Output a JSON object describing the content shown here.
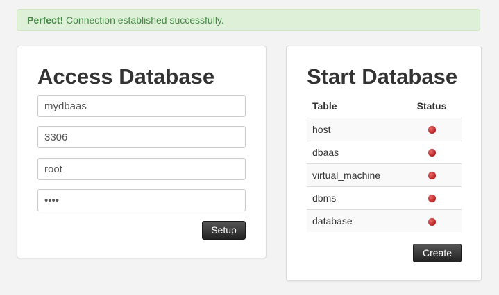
{
  "alert": {
    "strong": "Perfect!",
    "message": " Connection established successfully."
  },
  "access": {
    "title": "Access Database",
    "fields": [
      {
        "value": "mydbaas"
      },
      {
        "value": "3306"
      },
      {
        "value": "root"
      },
      {
        "value": "••••"
      }
    ],
    "setup_label": "Setup"
  },
  "start": {
    "title": "Start Database",
    "headers": {
      "table": "Table",
      "status": "Status"
    },
    "rows": [
      {
        "table": "host",
        "status": "status-red-dot-icon"
      },
      {
        "table": "dbaas",
        "status": "status-red-dot-icon"
      },
      {
        "table": "virtual_machine",
        "status": "status-red-dot-icon"
      },
      {
        "table": "dbms",
        "status": "status-red-dot-icon"
      },
      {
        "table": "database",
        "status": "status-red-dot-icon"
      }
    ],
    "create_label": "Create"
  },
  "colors": {
    "alert_bg": "#dff0d8",
    "alert_text": "#468847",
    "status_red": "#c9302c",
    "button_dark": "#333333"
  }
}
